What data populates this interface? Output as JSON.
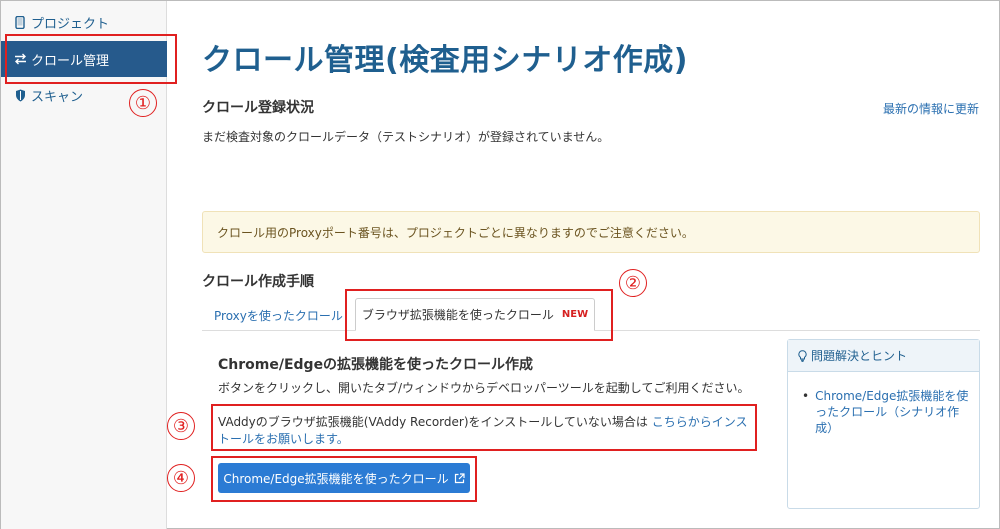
{
  "sidebar": {
    "items": [
      {
        "label": "プロジェクト",
        "icon": "tablet-icon"
      },
      {
        "label": "クロール管理",
        "icon": "arrows-exchange-icon"
      },
      {
        "label": "スキャン",
        "icon": "shield-icon"
      }
    ]
  },
  "annotations": [
    "①",
    "②",
    "③",
    "④"
  ],
  "page": {
    "title": "クロール管理(検査用シナリオ作成)",
    "status_heading": "クロール登録状況",
    "refresh_link": "最新の情報に更新",
    "status_text": "まだ検査対象のクロールデータ（テストシナリオ）が登録されていません。",
    "notice": "クロール用のProxyポート番号は、プロジェクトごとに異なりますのでご注意ください。",
    "steps_heading": "クロール作成手順",
    "tabs": [
      {
        "label": "Proxyを使ったクロール"
      },
      {
        "label": "ブラウザ拡張機能を使ったクロール",
        "badge": "NEW"
      }
    ],
    "section_heading": "Chrome/Edgeの拡張機能を使ったクロール作成",
    "section_text": "ボタンをクリックし、開いたタブ/ウィンドウからデベロッパーツールを起動してご利用ください。",
    "install_text": "VAddyのブラウザ拡張機能(VAddy Recorder)をインストールしていない場合は ",
    "install_link": "こちらからインストールをお願いします。",
    "action_button": "Chrome/Edge拡張機能を使ったクロール"
  },
  "hint_panel": {
    "title": "問題解決とヒント",
    "items": [
      "Chrome/Edge拡張機能を使ったクロール（シナリオ作成）"
    ]
  },
  "colors": {
    "accent": "#1f5f8f",
    "sidebar_active": "#265a8c",
    "annotation": "#e02020",
    "button": "#2b7bd4"
  }
}
